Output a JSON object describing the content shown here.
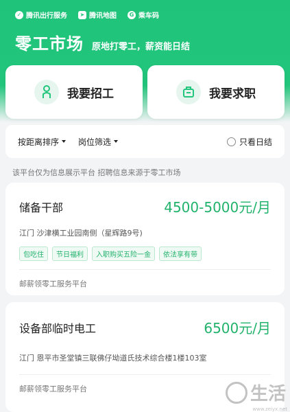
{
  "header": {
    "partners": [
      {
        "label": "腾讯出行服务",
        "icon": "check-circle-icon"
      },
      {
        "label": "腾讯地图",
        "icon": "map-icon"
      },
      {
        "label": "乘车码",
        "icon": "g-logo-icon"
      }
    ],
    "title": "零工市场",
    "subtitle": "原地打零工，薪资能日结"
  },
  "actions": {
    "hire_label": "我要招工",
    "seek_label": "我要求职"
  },
  "filters": {
    "sort_label": "按距离排序",
    "position_label": "岗位筛选",
    "daily_only_label": "只看日结",
    "daily_only_checked": false
  },
  "notice": "该平台仅为信息展示平台 招聘信息来源于零工市场",
  "jobs": [
    {
      "title": "储备干部",
      "salary": "4500-5000元/月",
      "address": "江门 沙津横工业园南侧（星辉路9号)",
      "tags": [
        "包吃住",
        "节日福利",
        "入职购买五险一金",
        "依法享有带"
      ],
      "platform": "邮薪领零工服务平台"
    },
    {
      "title": "设备部临时电工",
      "salary": "6500元/月",
      "address": "江门 恩平市圣堂镇三联佛仔坳道氏技术综合楼1楼103室",
      "tags": [],
      "platform": "邮薪领零工服务平台"
    }
  ],
  "watermark": {
    "text": "生活",
    "url": "www.zeiyx.net"
  },
  "colors": {
    "brand_green": "#22c57c",
    "salary_green": "#21b26b"
  }
}
